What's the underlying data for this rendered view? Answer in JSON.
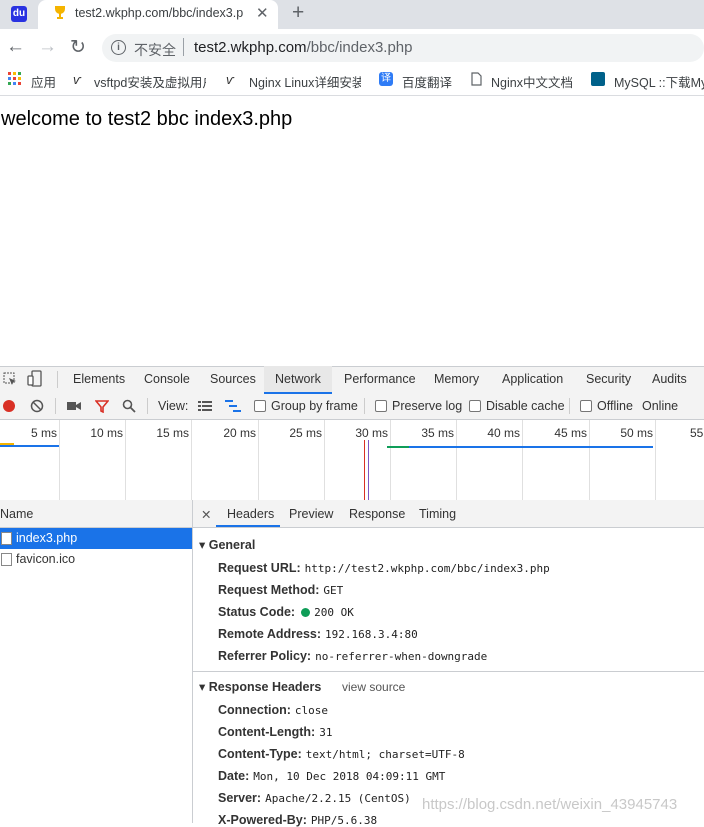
{
  "browser": {
    "tab": {
      "title": "test2.wkphp.com/bbc/index3.p",
      "close": "✕"
    },
    "new_tab": "+",
    "nav": {
      "back": "←",
      "forward": "→",
      "reload": "↻"
    },
    "omnibox": {
      "info": "i",
      "security_label": "不安全",
      "host": "test2.wkphp.com",
      "path": "/bbc/index3.php"
    },
    "bookmarks": [
      {
        "label": "应用",
        "icon": "apps-grid-icon"
      },
      {
        "label": "vsftpd安装及虚拟用户",
        "icon": "site-logo-icon"
      },
      {
        "label": "Nginx Linux详细安装",
        "icon": "site-logo-icon"
      },
      {
        "label": "百度翻译",
        "icon": "translate-icon"
      },
      {
        "label": "Nginx中文文档",
        "icon": "document-icon"
      },
      {
        "label": "MySQL ::下载My",
        "icon": "mysql-icon"
      }
    ]
  },
  "page": {
    "text": "welcome to test2 bbc index3.php"
  },
  "devtools": {
    "tabs": [
      "Elements",
      "Console",
      "Sources",
      "Network",
      "Performance",
      "Memory",
      "Application",
      "Security",
      "Audits"
    ],
    "active_tab": "Network",
    "toolbar": {
      "view_label": "View:",
      "group_by_frame": "Group by frame",
      "preserve_log": "Preserve log",
      "disable_cache": "Disable cache",
      "offline": "Offline",
      "online": "Online"
    },
    "timeline_ticks": [
      "5 ms",
      "10 ms",
      "15 ms",
      "20 ms",
      "25 ms",
      "30 ms",
      "35 ms",
      "40 ms",
      "45 ms",
      "50 ms",
      "55"
    ],
    "name_header": "Name",
    "requests": [
      {
        "name": "index3.php",
        "selected": true
      },
      {
        "name": "favicon.ico",
        "selected": false
      }
    ],
    "detail_tabs": {
      "close": "✕",
      "items": [
        "Headers",
        "Preview",
        "Response",
        "Timing"
      ],
      "active": "Headers"
    },
    "general": {
      "title": "General",
      "rows": [
        {
          "key": "Request URL:",
          "value": "http://test2.wkphp.com/bbc/index3.php"
        },
        {
          "key": "Request Method:",
          "value": "GET"
        },
        {
          "key": "Status Code:",
          "value": "200 OK"
        },
        {
          "key": "Remote Address:",
          "value": "192.168.3.4:80"
        },
        {
          "key": "Referrer Policy:",
          "value": "no-referrer-when-downgrade"
        }
      ]
    },
    "response_headers": {
      "title": "Response Headers",
      "view_source": "view source",
      "rows": [
        {
          "key": "Connection:",
          "value": "close"
        },
        {
          "key": "Content-Length:",
          "value": "31"
        },
        {
          "key": "Content-Type:",
          "value": "text/html; charset=UTF-8"
        },
        {
          "key": "Date:",
          "value": "Mon, 10 Dec 2018 04:09:11 GMT"
        },
        {
          "key": "Server:",
          "value": "Apache/2.2.15 (CentOS)"
        },
        {
          "key": "X-Powered-By:",
          "value": "PHP/5.6.38"
        }
      ]
    }
  },
  "watermark": "https://blog.csdn.net/weixin_43945743",
  "colors": {
    "accent": "#1a73e8",
    "status_ok": "#0f9d58",
    "record": "#d93025"
  }
}
